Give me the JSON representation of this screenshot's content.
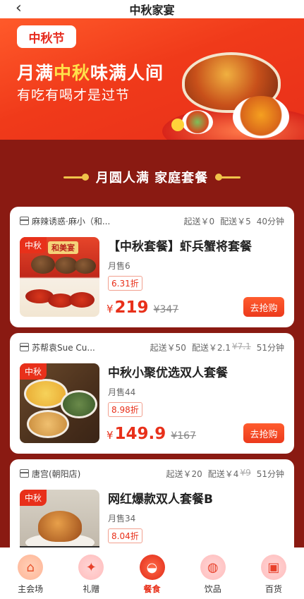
{
  "header": {
    "back_icon": "chevron-left-icon",
    "title": "中秋家宴"
  },
  "banner": {
    "logo": "中秋节",
    "headline_pre": "月满",
    "headline_highlight": "中秋",
    "headline_post": "味满人间",
    "subline": "有吃有喝才是过节"
  },
  "section": {
    "title": "月圆人满 家庭套餐"
  },
  "cards": [
    {
      "shop": "麻辣诱惑·麻小（和...",
      "min_order": "起送￥0",
      "delivery": "配送￥5",
      "delivery_orig": "",
      "time": "40分钟",
      "tag": "中秋",
      "thumb_label": "和美宴",
      "name": "【中秋套餐】虾兵蟹将套餐",
      "sold": "月售6",
      "discount": "6.31折",
      "currency": "¥",
      "price": "219",
      "orig_price": "¥347",
      "buy": "去抢购"
    },
    {
      "shop": "苏帮袁Sue Cu...",
      "min_order": "起送￥50",
      "delivery": "配送￥2.1",
      "delivery_orig": "¥7.1",
      "time": "51分钟",
      "tag": "中秋",
      "name": "中秋小聚优选双人套餐",
      "sold": "月售44",
      "discount": "8.98折",
      "currency": "¥",
      "price": "149.9",
      "orig_price": "¥167",
      "buy": "去抢购"
    },
    {
      "shop": "唐宫(朝阳店)",
      "min_order": "起送￥20",
      "delivery": "配送￥4",
      "delivery_orig": "¥9",
      "time": "51分钟",
      "tag": "中秋",
      "name": "网红爆款双人套餐B",
      "sold": "月售34",
      "discount": "8.04折"
    }
  ],
  "tabs": [
    {
      "label": "主会场",
      "icon": "home-icon",
      "glyph": "⌂"
    },
    {
      "label": "礼赠",
      "icon": "gift-icon",
      "glyph": "✦"
    },
    {
      "label": "餐食",
      "icon": "bowl-icon",
      "glyph": "◒",
      "active": true
    },
    {
      "label": "饮品",
      "icon": "drink-icon",
      "glyph": "◍"
    },
    {
      "label": "百货",
      "icon": "shopping-icon",
      "glyph": "▣"
    }
  ],
  "colors": {
    "accent": "#e8301a",
    "page_bg": "#8a1a12",
    "gold": "#f0c34a"
  }
}
